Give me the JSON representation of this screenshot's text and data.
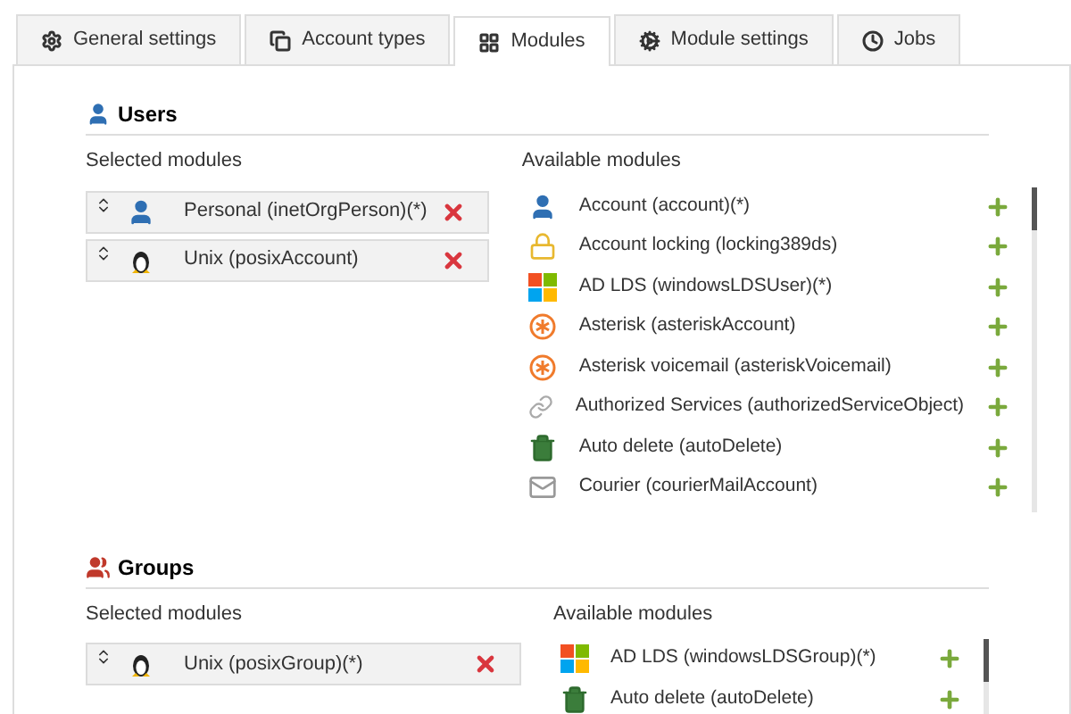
{
  "tabs": [
    {
      "label": "General settings",
      "selected": false
    },
    {
      "label": "Account types",
      "selected": false
    },
    {
      "label": "Modules",
      "selected": true
    },
    {
      "label": "Module settings",
      "selected": false
    },
    {
      "label": "Jobs",
      "selected": false
    }
  ],
  "sections": [
    {
      "title": "Users",
      "kind": "users",
      "selected_label": "Selected modules",
      "available_label": "Available modules",
      "selected": [
        {
          "name": "Personal (inetOrgPerson)(*)",
          "kind": "person"
        },
        {
          "name": "Unix (posixAccount)",
          "kind": "linux"
        }
      ],
      "available": [
        {
          "name": "Account (account)(*)",
          "kind": "person"
        },
        {
          "name": "Account locking (locking389ds)",
          "kind": "lock"
        },
        {
          "name": "AD LDS (windowsLDSUser)(*)",
          "kind": "windows"
        },
        {
          "name": "Asterisk (asteriskAccount)",
          "kind": "asterisk"
        },
        {
          "name": "Asterisk voicemail (asteriskVoicemail)",
          "kind": "asterisk"
        },
        {
          "name": "Authorized Services (authorizedServiceObject)",
          "kind": "link"
        },
        {
          "name": "Auto delete (autoDelete)",
          "kind": "trash"
        },
        {
          "name": "Courier (courierMailAccount)",
          "kind": "mail"
        }
      ]
    },
    {
      "title": "Groups",
      "kind": "groups",
      "selected_label": "Selected modules",
      "available_label": "Available modules",
      "selected": [
        {
          "name": "Unix (posixGroup)(*)",
          "kind": "linux"
        }
      ],
      "available": [
        {
          "name": "AD LDS (windowsLDSGroup)(*)",
          "kind": "windows"
        },
        {
          "name": "Auto delete (autoDelete)",
          "kind": "trash"
        }
      ]
    }
  ]
}
